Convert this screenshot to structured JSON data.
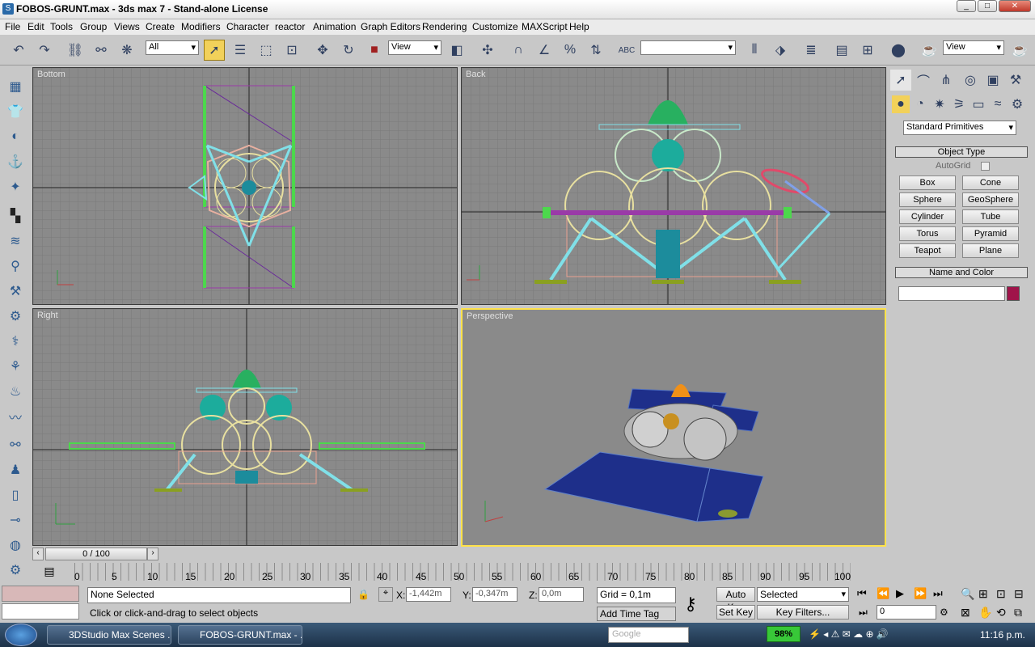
{
  "window": {
    "title": "FOBOS-GRUNT.max - 3ds max 7  - Stand-alone License"
  },
  "menu": [
    "File",
    "Edit",
    "Tools",
    "Group",
    "Views",
    "Create",
    "Modifiers",
    "Character",
    "reactor",
    "Animation",
    "Graph Editors",
    "Rendering",
    "Customize",
    "MAXScript",
    "Help"
  ],
  "toolbar": {
    "selection_filter": "All",
    "ref_coord": "View",
    "named_sel": "",
    "render_type": "View"
  },
  "viewports": {
    "top_left": "Bottom",
    "top_right": "Back",
    "bottom_left": "Right",
    "bottom_right": "Perspective"
  },
  "command_panel": {
    "category": "Standard Primitives",
    "object_type_header": "Object Type",
    "autogrid_label": "AutoGrid",
    "buttons": [
      "Box",
      "Cone",
      "Sphere",
      "GeoSphere",
      "Cylinder",
      "Tube",
      "Torus",
      "Pyramid",
      "Teapot",
      "Plane"
    ],
    "name_color_header": "Name and Color",
    "name_value": "",
    "color": "#a0144a"
  },
  "timeline": {
    "slider_label": "0 / 100",
    "ticks": [
      "0",
      "5",
      "10",
      "15",
      "20",
      "25",
      "30",
      "35",
      "40",
      "45",
      "50",
      "55",
      "60",
      "65",
      "70",
      "75",
      "80",
      "85",
      "90",
      "95",
      "100"
    ]
  },
  "status": {
    "selection": "None Selected",
    "prompt": "Click or click-and-drag to select objects",
    "x_label": "X:",
    "x_value": "-1,442m",
    "y_label": "Y:",
    "y_value": "-0,347m",
    "z_label": "Z:",
    "z_value": "0,0m",
    "grid": "Grid = 0,1m",
    "add_time_tag": "Add Time Tag",
    "auto_key": "Auto Key",
    "set_key": "Set Key",
    "key_mode": "Selected",
    "key_filters": "Key Filters...",
    "frame": "0"
  },
  "taskbar": {
    "items": [
      "3DStudio Max Scenes ...",
      "FOBOS-GRUNT.max - ..."
    ],
    "battery": "98%",
    "clock": "11:16 p.m.",
    "search_placeholder": "Google"
  }
}
